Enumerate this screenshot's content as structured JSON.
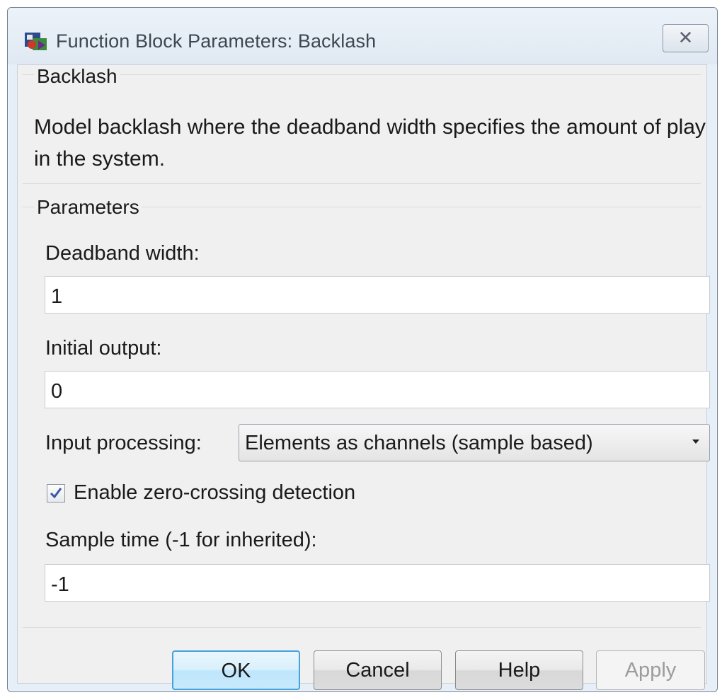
{
  "window": {
    "title": "Function Block Parameters: Backlash",
    "close_glyph": "✕",
    "app_icon": "simulink-block-icon"
  },
  "description_group": {
    "title": "Backlash",
    "text": "Model backlash where the deadband width specifies the amount of play in the system."
  },
  "parameters_group": {
    "title": "Parameters",
    "deadband_width": {
      "label": "Deadband width:",
      "value": "1"
    },
    "initial_output": {
      "label": "Initial output:",
      "value": "0"
    },
    "input_processing": {
      "label": "Input processing:",
      "selected": "Elements as channels (sample based)"
    },
    "zero_crossing": {
      "label": "Enable zero-crossing detection",
      "checked": true
    },
    "sample_time": {
      "label": "Sample time (-1 for inherited):",
      "value": "-1"
    }
  },
  "buttons": {
    "ok": "OK",
    "cancel": "Cancel",
    "help": "Help",
    "apply": "Apply"
  },
  "colors": {
    "default_button_border": "#45a2db",
    "checkmark": "#3a56a8"
  }
}
